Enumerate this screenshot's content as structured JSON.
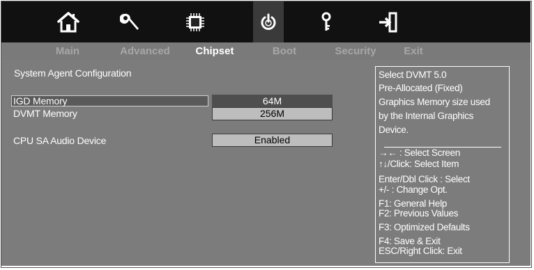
{
  "toolbar": {
    "icons": [
      {
        "name": "home-icon"
      },
      {
        "name": "wrench-icon"
      },
      {
        "name": "chip-icon"
      },
      {
        "name": "power-icon"
      },
      {
        "name": "key-icon"
      },
      {
        "name": "exit-icon"
      }
    ]
  },
  "tabs": [
    {
      "label": "Main",
      "active": false
    },
    {
      "label": "Advanced",
      "active": false
    },
    {
      "label": "Chipset",
      "active": true
    },
    {
      "label": "Boot",
      "active": false
    },
    {
      "label": "Security",
      "active": false
    },
    {
      "label": "Exit",
      "active": false
    }
  ],
  "section": {
    "title": "System Agent Configuration"
  },
  "settings": [
    {
      "label": "IGD Memory",
      "value": "64M",
      "selected": true
    },
    {
      "label": "DVMT Memory",
      "value": "256M",
      "selected": false
    },
    {
      "label": "CPU SA Audio Device",
      "value": "Enabled",
      "selected": false
    }
  ],
  "help": {
    "description": [
      "Select DVMT 5.0",
      "Pre-Allocated (Fixed)",
      "Graphics Memory size used",
      "by the Internal Graphics",
      "Device."
    ],
    "keys": [
      "→← : Select Screen",
      "↑↓/Click: Select Item",
      "Enter/Dbl Click : Select",
      "+/- : Change Opt.",
      "F1: General Help",
      "F2: Previous Values",
      "F3: Optimized Defaults",
      "F4: Save & Exit",
      "ESC/Right Click: Exit"
    ]
  },
  "colors": {
    "background": "#7c7c7c",
    "iconbar": "#111111",
    "selected_value": "#4e4e4e",
    "normal_value": "#bdbdbd"
  }
}
